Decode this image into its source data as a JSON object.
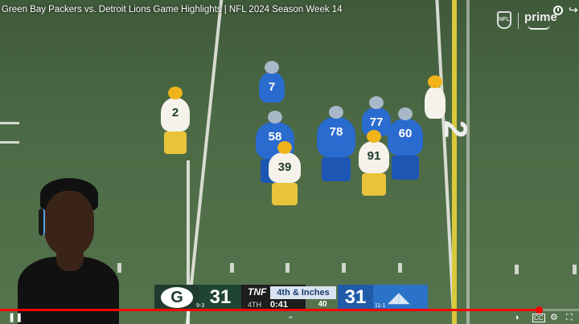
{
  "video": {
    "title": "Green Bay Packers vs. Detroit Lions Game Highlights | NFL 2024 Season Week 14"
  },
  "field": {
    "yard_number": "2"
  },
  "players": [
    {
      "team": "gb",
      "number": "2"
    },
    {
      "team": "det",
      "number": "7"
    },
    {
      "team": "det",
      "number": "58"
    },
    {
      "team": "det",
      "number": "78"
    },
    {
      "team": "det",
      "number": "77"
    },
    {
      "team": "det",
      "number": "60"
    },
    {
      "team": "gb",
      "number": "39"
    },
    {
      "team": "gb",
      "number": "91"
    }
  ],
  "overlay": {
    "nfl_logo_text": "NFL",
    "prime_logo_text": "prime"
  },
  "scorebug": {
    "home_team_logo": "G",
    "home_record": "9-3",
    "home_score": "31",
    "network": "TNF",
    "down_distance": "4th & Inches",
    "quarter": "4TH",
    "game_clock": "0:41",
    "play_clock": "40",
    "away_score": "31",
    "away_record": "11-1",
    "colors": {
      "packers": "#203c2f",
      "lions": "#2a73c8"
    }
  },
  "player": {
    "progress_percent": 93,
    "icons": {
      "pause": "pause-icon",
      "chevron": "chevron-up-icon",
      "settings": "gear-icon",
      "fullscreen": "fullscreen-icon"
    }
  }
}
